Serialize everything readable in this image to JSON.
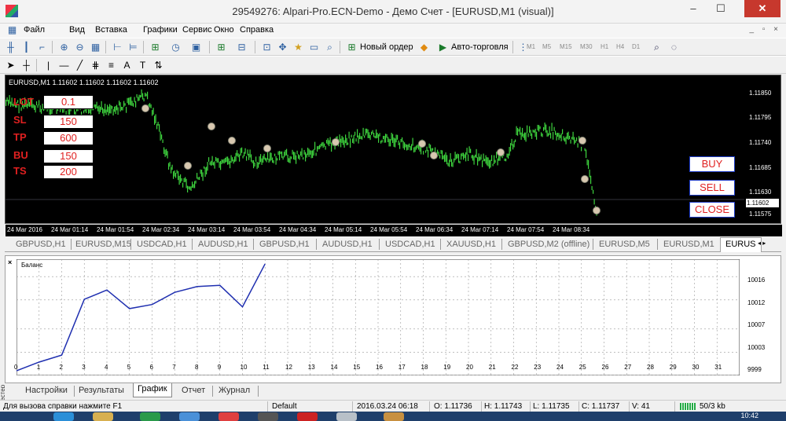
{
  "window": {
    "title": "29549276: Alpari-Pro.ECN-Demo - Демо Счет - [EURUSD,M1 (visual)]",
    "minimize": "–",
    "maximize": "☐",
    "close": "✕"
  },
  "menu": [
    "Файл",
    "Вид",
    "Вставка",
    "Графики",
    "Сервис",
    "Окно",
    "Справка"
  ],
  "mdi_buttons": "_ ▫ ×",
  "toolbar": {
    "new_order": "Новый ордер",
    "autotrading": "Авто-торговля",
    "timeframes": [
      "M1",
      "M5",
      "M15",
      "M30",
      "H1",
      "H4",
      "D1"
    ]
  },
  "chart": {
    "info": "EURUSD,M1  1.11602 1.11602 1.11602 1.11602",
    "panel": [
      {
        "label": "LOT",
        "value": "0.1"
      },
      {
        "label": "SL",
        "value": "150"
      },
      {
        "label": "TP",
        "value": "600"
      },
      {
        "label": "BU",
        "value": "150"
      },
      {
        "label": "TS",
        "value": "200"
      }
    ],
    "buttons": {
      "buy": "BUY",
      "sell": "SELL",
      "close": "CLOSE"
    },
    "price_labels": [
      "1.11850",
      "1.11795",
      "1.11740",
      "1.11685",
      "1.11630",
      "1.11575"
    ],
    "current_price": "1.11602",
    "time_labels": [
      "24 Mar 2016",
      "24 Mar 01:14",
      "24 Mar 01:54",
      "24 Mar 02:34",
      "24 Mar 03:14",
      "24 Mar 03:54",
      "24 Mar 04:34",
      "24 Mar 05:14",
      "24 Mar 05:54",
      "24 Mar 06:34",
      "24 Mar 07:14",
      "24 Mar 07:54",
      "24 Mar 08:34"
    ]
  },
  "tabs": [
    "GBPUSD,H1",
    "EURUSD,M15",
    "USDCAD,H1",
    "AUDUSD,H1",
    "GBPUSD,H1",
    "AUDUSD,H1",
    "USDCAD,H1",
    "XAUUSD,H1",
    "GBPUSD,M2 (offline)",
    "EURUSD,M5",
    "EURUSD,M1",
    "EURUS"
  ],
  "tab_arrows": "◂ ▸",
  "tester": {
    "close": "×",
    "side_label": "Тестер",
    "chart_data": {
      "type": "line",
      "title": "Баланс",
      "x": [
        0,
        1,
        2,
        3,
        4,
        5,
        6,
        7,
        8,
        9,
        10,
        11
      ],
      "values": [
        9999.8,
        10001.3,
        10002.5,
        10012.1,
        10013.7,
        10010.5,
        10011.2,
        10013.3,
        10014.3,
        10014.5,
        10010.8,
        10018.2
      ],
      "xlim": [
        0,
        32
      ],
      "ylim": [
        9999,
        10019
      ],
      "x_ticks": [
        "0",
        "1",
        "2",
        "3",
        "4",
        "5",
        "6",
        "7",
        "8",
        "9",
        "10",
        "11",
        "12",
        "13",
        "14",
        "15",
        "16",
        "17",
        "18",
        "19",
        "20",
        "21",
        "22",
        "23",
        "24",
        "25",
        "26",
        "27",
        "28",
        "29",
        "30",
        "31"
      ],
      "y_ticks": [
        "10016",
        "10012",
        "10007",
        "10003",
        "9999"
      ],
      "grid": true,
      "color": "#1f2fb0"
    },
    "subtabs": [
      "Настройки",
      "Результаты",
      "График",
      "Отчет",
      "Журнал"
    ]
  },
  "status": {
    "help": "Для вызова справки нажмите F1",
    "profile": "Default",
    "datetime": "2016.03.24 06:18",
    "open": "O: 1.11736",
    "high": "H: 1.11743",
    "low": "L: 1.11735",
    "close": "C: 1.11737",
    "volume": "V: 41",
    "traffic": "50/3 kb"
  },
  "taskbar": {
    "clock": "10:42"
  }
}
